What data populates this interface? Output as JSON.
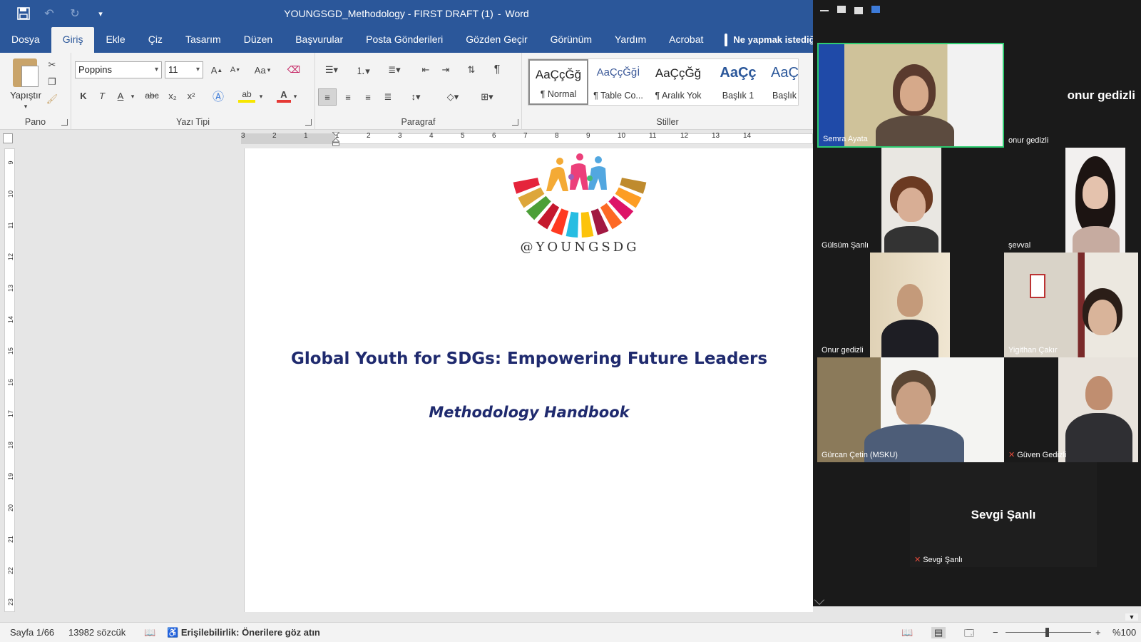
{
  "window": {
    "title_file": "YOUNGSGD_Methodology - FIRST DRAFT (1)",
    "title_sep": "-",
    "title_app": "Word"
  },
  "tabs": [
    "Dosya",
    "Giriş",
    "Ekle",
    "Çiz",
    "Tasarım",
    "Düzen",
    "Başvurular",
    "Posta Gönderileri",
    "Gözden Geçir",
    "Görünüm",
    "Yardım",
    "Acrobat"
  ],
  "tell_me": "Ne yapmak istediğ",
  "ribbon": {
    "clipboard": {
      "paste_label": "Yapıştır",
      "group_label": "Pano"
    },
    "font": {
      "family": "Poppins",
      "size": "11",
      "case_btn": "Aa",
      "bold": "K",
      "italic": "T",
      "underline": "A",
      "strike": "abc",
      "sub": "x₂",
      "sup": "x²",
      "highlight": "ab",
      "color": "A",
      "group_label": "Yazı Tipi"
    },
    "paragraph": {
      "group_label": "Paragraf"
    },
    "styles": {
      "group_label": "Stiller",
      "items": [
        {
          "sample": "AaÇçĞğ",
          "name": "¶ Normal",
          "selected": true
        },
        {
          "sample": "AaÇçĞğİ",
          "name": "¶ Table Co...",
          "selected": false
        },
        {
          "sample": "AaÇçĞğ",
          "name": "¶ Aralık Yok",
          "selected": false
        },
        {
          "sample": "AaÇç",
          "name": "Başlık 1",
          "selected": false
        },
        {
          "sample": "AaÇ",
          "name": "Başlık",
          "selected": false
        }
      ]
    }
  },
  "ruler": {
    "h_numbers": [
      "3",
      "2",
      "1",
      "1",
      "2",
      "3",
      "4",
      "5",
      "6",
      "7",
      "8",
      "9",
      "10",
      "11",
      "12",
      "13",
      "14"
    ],
    "v_numbers": [
      "9",
      "10",
      "11",
      "12",
      "13",
      "14",
      "15",
      "16",
      "17",
      "18",
      "19",
      "20",
      "21",
      "22",
      "23"
    ]
  },
  "document": {
    "logo_text": "@YOUNGSDG",
    "heading": "Global Youth for SDGs: Empowering Future Leaders",
    "subheading": "Methodology Handbook"
  },
  "status": {
    "page": "Sayfa 1/66",
    "words": "13982 sözcük",
    "accessibility": "Erişilebilirlik: Önerilere göz atın",
    "zoom": "%100",
    "zoom_fraction": 0.48
  },
  "call": {
    "participants": [
      {
        "name": "Semra Ayata",
        "video": true,
        "speaking": true
      },
      {
        "name": "onur gedizli",
        "video": false,
        "big_name": "onur gedizli"
      },
      {
        "name": "Gülsüm Şanlı",
        "video": true
      },
      {
        "name": "şevval",
        "video": true
      },
      {
        "name": "Onur gedizli",
        "video": true
      },
      {
        "name": "Yigithan Çakır",
        "video": true
      },
      {
        "name": "Gürcan Çetin (MSKU)",
        "video": true
      },
      {
        "name": "Güven Gedizli",
        "video": true,
        "muted": true
      },
      {
        "name": "Sevgi Şanlı",
        "video": false,
        "muted": true,
        "big_name": "Sevgi Şanlı"
      }
    ]
  },
  "colors": {
    "word_blue": "#2b579a",
    "doc_heading": "#1f2a6e",
    "speaking_border": "#2ecc71",
    "call_bg": "#1a1a1a"
  }
}
